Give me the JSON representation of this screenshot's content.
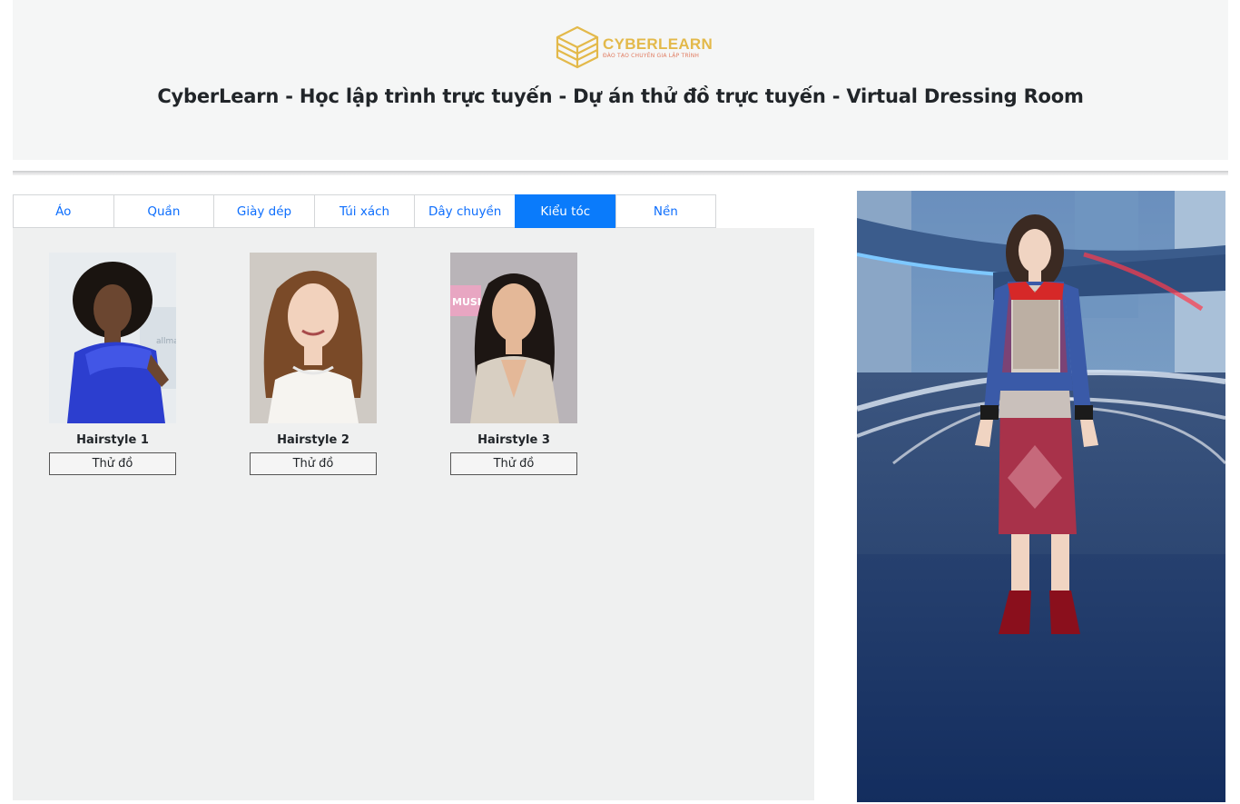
{
  "header": {
    "logo_name": "CYBERLEARN",
    "logo_tagline": "ĐÀO TẠO CHUYÊN GIA LẬP TRÌNH",
    "title": "CyberLearn - Học lập trình trực tuyến - Dự án thử đồ trực tuyến - Virtual Dressing Room"
  },
  "tabs": [
    {
      "label": "Áo",
      "active": false
    },
    {
      "label": "Quần",
      "active": false
    },
    {
      "label": "Giày dép",
      "active": false
    },
    {
      "label": "Túi xách",
      "active": false
    },
    {
      "label": "Dây chuyền",
      "active": false
    },
    {
      "label": "Kiểu tóc",
      "active": true
    },
    {
      "label": "Nền",
      "active": false
    }
  ],
  "items": [
    {
      "name": "Hairstyle 1",
      "button": "Thử đồ"
    },
    {
      "name": "Hairstyle 2",
      "button": "Thử đồ"
    },
    {
      "name": "Hairstyle 3",
      "button": "Thử đồ"
    }
  ],
  "colors": {
    "accent": "#0a7bfb",
    "link": "#0d6efd",
    "header_bg": "#f5f6f6",
    "panel_bg": "#eff0f0",
    "logo_gold": "#e3b94a"
  }
}
